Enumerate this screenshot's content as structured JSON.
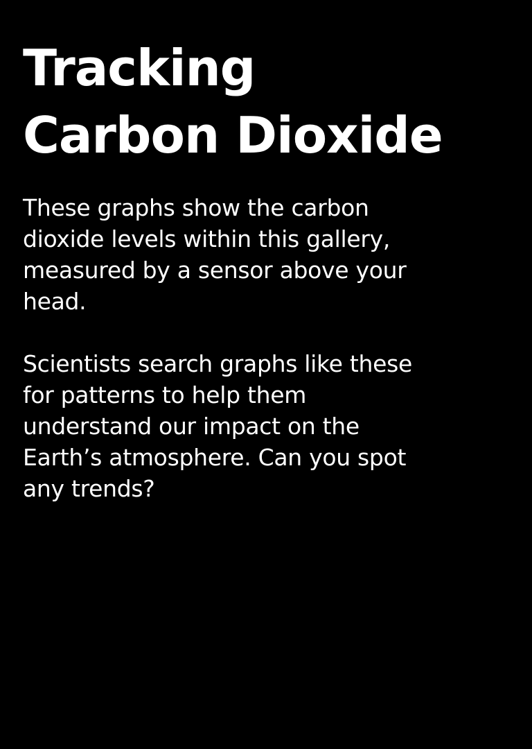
{
  "title_lines": [
    "Tracking",
    "Carbon Dioxide"
  ],
  "paragraph1_lines": [
    "These graphs show the carbon",
    "dioxide levels within this gallery,",
    "measured by a sensor above your",
    "head."
  ],
  "paragraph2_lines": [
    "Scientists search graphs like these",
    "for patterns to help them",
    "understand our impact on the",
    "Earth’s atmosphere. Can you spot",
    "any trends?"
  ],
  "colors": {
    "background": "#000000",
    "text": "#ffffff"
  }
}
